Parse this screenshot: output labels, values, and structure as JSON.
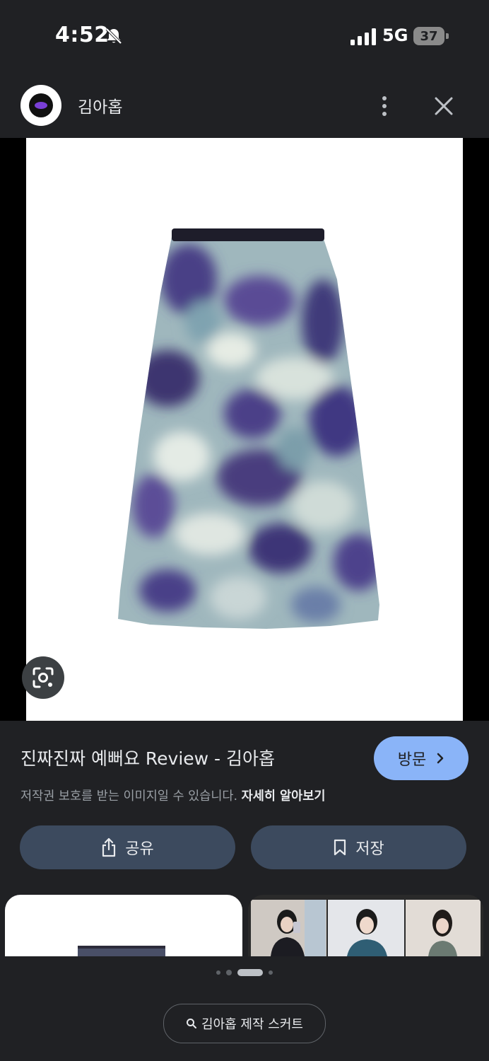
{
  "status_bar": {
    "time": "4:52",
    "network": "5G",
    "battery": "37"
  },
  "header": {
    "site_name": "김아홉",
    "icons": [
      "bell-off-icon",
      "signal-icon",
      "more-vert-icon",
      "close-icon"
    ]
  },
  "image": {
    "subject": "tie-dye midi skirt"
  },
  "info": {
    "title": "진짜진짜 예뻐요 Review - 김아홉",
    "visit_label": "방문",
    "copyright_text": "저작권 보호를 받는 이미지일 수 있습니다.",
    "learn_more": "자세히 알아보기",
    "share_label": "공유",
    "save_label": "저장"
  },
  "related": {
    "search_chip": "김아홉 제작 스커트"
  },
  "colors": {
    "background": "#202124",
    "accent_button": "#8ab4f8",
    "pill_button": "#3c4a5e",
    "text_secondary": "#9aa0a6"
  }
}
